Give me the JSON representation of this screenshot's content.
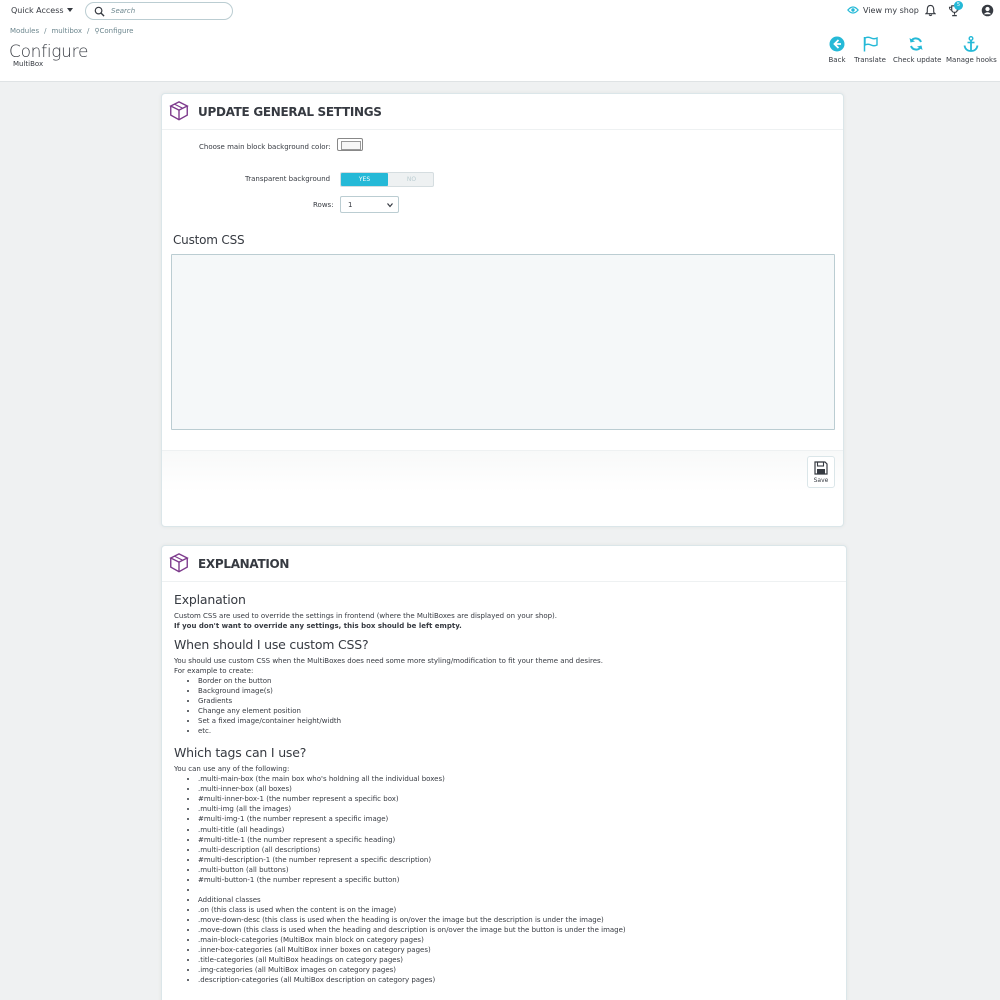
{
  "topbar": {
    "quick_access": "Quick Access",
    "search_placeholder": "Search",
    "view_shop": "View my shop",
    "notification_count": "5"
  },
  "breadcrumb": [
    "Modules",
    "multibox",
    "Configure"
  ],
  "header": {
    "title": "Configure",
    "subtitle": "MultiBox"
  },
  "toolbar": {
    "back": "Back",
    "translate": "Translate",
    "check_update": "Check update",
    "manage_hooks": "Manage hooks"
  },
  "settings_panel": {
    "title": "UPDATE GENERAL SETTINGS",
    "bg_color_label": "Choose main block background color:",
    "transparent_label": "Transparent background",
    "switch_yes": "YES",
    "switch_no": "NO",
    "rows_label": "Rows:",
    "rows_value": "1",
    "custom_css_title": "Custom CSS",
    "save_label": "Save"
  },
  "explanation_panel": {
    "title": "EXPLANATION",
    "h_explanation": "Explanation",
    "p1": "Custom CSS are used to override the settings in frontend (where the MultiBoxes are displayed on your shop).",
    "p2_bold": "If you don't want to override any settings, this box should be left empty.",
    "h_when": "When should I use custom CSS?",
    "p3": "You should use custom CSS when the MultiBoxes does need some more styling/modification to fit your theme and desires.",
    "p4": "For example to create:",
    "examples": [
      "Border on the button",
      "Background image(s)",
      "Gradients",
      "Change any element position",
      "Set a fixed image/container height/width",
      "etc."
    ],
    "h_tags": "Which tags can I use?",
    "p5": "You can use any of the following:",
    "tags": [
      ".multi-main-box (the main box who's holdning all the individual boxes)",
      ".multi-inner-box (all boxes)",
      "#multi-inner-box-1 (the number represent a specific box)",
      ".multi-img (all the images)",
      "#multi-img-1 (the number represent a specific image)",
      ".multi-title (all headings)",
      "#multi-title-1 (the number represent a specific heading)",
      ".multi-description (all descriptions)",
      "#multi-description-1 (the number represent a specific description)",
      ".multi-button (all buttons)",
      "#multi-button-1 (the number represent a specific button)",
      "",
      "Additional classes",
      ".on (this class is used when the content is on the image)",
      ".move-down-desc (this class is used when the heading is on/over the image but the description is under the image)",
      ".move-down (this class is used when the heading and description is on/over the image but the button is under the image)",
      ".main-block-categories (MultiBox main block on category pages)",
      ".inner-box-categories (all MultiBox inner boxes on category pages)",
      ".title-categories (all MultiBox headings on category pages)",
      ".img-categories (all MultiBox images on category pages)",
      ".description-categories (all MultiBox description on category pages)"
    ]
  },
  "colors": {
    "accent": "#25b9d7",
    "brand_icon": "#7d3a8c",
    "text": "#363a41"
  }
}
